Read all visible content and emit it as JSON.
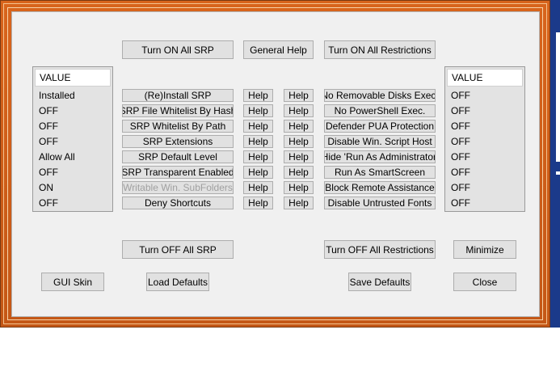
{
  "top_buttons": {
    "turn_on_all_srp": "Turn ON All SRP",
    "general_help": "General Help",
    "turn_on_all_restrictions": "Turn ON All Restrictions"
  },
  "srp_status": {
    "header": "VALUE",
    "values": [
      "Installed",
      "OFF",
      "OFF",
      "OFF",
      "Allow All",
      "OFF",
      "ON",
      "OFF"
    ]
  },
  "srp_options": [
    {
      "label": "(Re)Install SRP",
      "enabled": true
    },
    {
      "label": "SRP File Whitelist By Hash",
      "enabled": true
    },
    {
      "label": "SRP Whitelist By Path",
      "enabled": true
    },
    {
      "label": "SRP Extensions",
      "enabled": true
    },
    {
      "label": "SRP Default Level",
      "enabled": true
    },
    {
      "label": "SRP Transparent Enabled",
      "enabled": true
    },
    {
      "label": "Writable Win. SubFolders",
      "enabled": false
    },
    {
      "label": "Deny Shortcuts",
      "enabled": true
    }
  ],
  "help_label": "Help",
  "restriction_options": [
    "No Removable Disks Exec.",
    "No PowerShell Exec.",
    "Defender PUA Protection",
    "Disable Win. Script Host",
    "Hide  'Run As Administrator'",
    "Run As SmartScreen",
    "Block Remote Assistance",
    "Disable Untrusted Fonts"
  ],
  "restriction_status": {
    "header": "VALUE",
    "values": [
      "OFF",
      "OFF",
      "OFF",
      "OFF",
      "OFF",
      "OFF",
      "OFF",
      "OFF"
    ]
  },
  "bottom_buttons": {
    "turn_off_all_srp": "Turn OFF All SRP",
    "turn_off_all_restrictions": "Turn OFF All Restrictions",
    "minimize": "Minimize",
    "gui_skin": "GUI Skin",
    "load_defaults": "Load Defaults",
    "save_defaults": "Save Defaults",
    "close": "Close"
  },
  "colors": {
    "frame": "#c8581a",
    "client": "#f0f0f0",
    "button": "#e1e1e1",
    "disabled_text": "#a0a0a0"
  }
}
